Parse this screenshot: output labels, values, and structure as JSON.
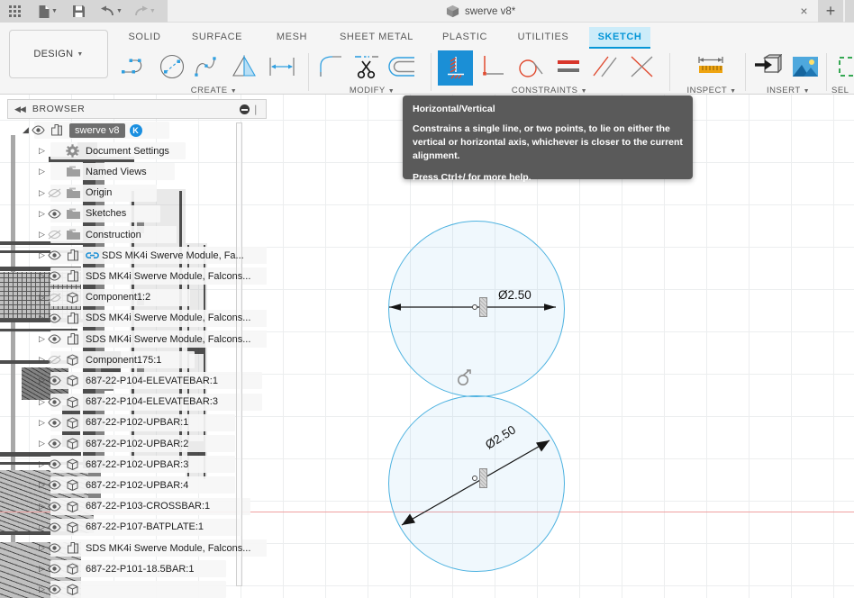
{
  "app": {
    "document_tab": "swerve v8*",
    "close_label": "×",
    "new_tab_label": "+"
  },
  "quick_access": {
    "items": [
      {
        "name": "app-grid-icon",
        "label": "grid-icon"
      },
      {
        "name": "new-file-icon",
        "label": "file-icon"
      },
      {
        "name": "save-icon",
        "label": "save-icon"
      },
      {
        "name": "undo-icon",
        "label": "undo-icon"
      },
      {
        "name": "redo-icon",
        "label": "redo-icon"
      }
    ]
  },
  "ribbon": {
    "design_button": "DESIGN",
    "workspace_tabs": [
      {
        "label": "SOLID",
        "active": false
      },
      {
        "label": "SURFACE",
        "active": false
      },
      {
        "label": "MESH",
        "active": false
      },
      {
        "label": "SHEET METAL",
        "active": false
      },
      {
        "label": "PLASTIC",
        "active": false
      },
      {
        "label": "UTILITIES",
        "active": false
      },
      {
        "label": "SKETCH",
        "active": true
      }
    ],
    "groups": [
      {
        "label": "CREATE",
        "tools": [
          "line-icon",
          "circle-icon",
          "spline-icon",
          "mirror-icon",
          "sketch-dimension-icon"
        ]
      },
      {
        "label": "MODIFY",
        "tools": [
          "fillet-icon",
          "trim-scissors-icon",
          "offset-icon"
        ]
      },
      {
        "label": "CONSTRAINTS",
        "tools": [
          "horizontal-vertical-icon",
          "perpendicular-icon",
          "tangent-icon",
          "equal-icon",
          "parallel-icon",
          "midpoint-icon"
        ]
      },
      {
        "label": "INSPECT",
        "tools": [
          "measure-ruler-icon"
        ]
      },
      {
        "label": "INSERT",
        "tools": [
          "insert-derive-icon",
          "insert-canvas-image-icon"
        ]
      },
      {
        "label": "SEL",
        "tools": [
          "selection-filter-icon"
        ]
      }
    ]
  },
  "tooltip": {
    "title": "Horizontal/Vertical",
    "body": "Constrains a single line, or two points, to lie on either the vertical or horizontal axis, whichever is closer to the current alignment.",
    "footer": "Press Ctrl+/ for more help."
  },
  "browser": {
    "title": "BROWSER",
    "collapse_label": "◀◀",
    "items": [
      {
        "indent": 0,
        "arrow": "◢",
        "eye": "visible",
        "icon": "component-icon",
        "label": "swerve v8",
        "selected": true,
        "badge": "K",
        "link": false
      },
      {
        "indent": 1,
        "arrow": "▷",
        "eye": "none",
        "icon": "gear-icon",
        "label": "Document Settings",
        "selected": false,
        "badge": "",
        "link": false
      },
      {
        "indent": 1,
        "arrow": "▷",
        "eye": "none",
        "icon": "folder-icon",
        "label": "Named Views",
        "selected": false,
        "badge": "",
        "link": false
      },
      {
        "indent": 1,
        "arrow": "▷",
        "eye": "hidden",
        "icon": "folder-icon",
        "label": "Origin",
        "selected": false,
        "badge": "",
        "link": false
      },
      {
        "indent": 1,
        "arrow": "▷",
        "eye": "visible",
        "icon": "folder-icon",
        "label": "Sketches",
        "selected": false,
        "badge": "",
        "link": false
      },
      {
        "indent": 1,
        "arrow": "▷",
        "eye": "hidden",
        "icon": "folder-icon",
        "label": "Construction",
        "selected": false,
        "badge": "",
        "link": false
      },
      {
        "indent": 1,
        "arrow": "▷",
        "eye": "visible",
        "icon": "component-icon",
        "label": "SDS MK4i Swerve Module, Fa...",
        "selected": false,
        "badge": "",
        "link": true
      },
      {
        "indent": 1,
        "arrow": "▷",
        "eye": "visible",
        "icon": "component-icon",
        "label": "SDS MK4i Swerve Module, Falcons...",
        "selected": false,
        "badge": "",
        "link": false
      },
      {
        "indent": 1,
        "arrow": "▷",
        "eye": "hidden",
        "icon": "body-icon",
        "label": "Component1:2",
        "selected": false,
        "badge": "",
        "link": false
      },
      {
        "indent": 1,
        "arrow": "▷",
        "eye": "visible",
        "icon": "component-icon",
        "label": "SDS MK4i Swerve Module, Falcons...",
        "selected": false,
        "badge": "",
        "link": false
      },
      {
        "indent": 1,
        "arrow": "▷",
        "eye": "visible",
        "icon": "component-icon",
        "label": "SDS MK4i Swerve Module, Falcons...",
        "selected": false,
        "badge": "",
        "link": false
      },
      {
        "indent": 1,
        "arrow": "▷",
        "eye": "hidden",
        "icon": "body-icon",
        "label": "Component175:1",
        "selected": false,
        "badge": "",
        "link": false
      },
      {
        "indent": 1,
        "arrow": "▷",
        "eye": "visible",
        "icon": "body-icon",
        "label": "687-22-P104-ELEVATEBAR:1",
        "selected": false,
        "badge": "",
        "link": false
      },
      {
        "indent": 1,
        "arrow": "▷",
        "eye": "visible",
        "icon": "body-icon",
        "label": "687-22-P104-ELEVATEBAR:3",
        "selected": false,
        "badge": "",
        "link": false
      },
      {
        "indent": 1,
        "arrow": "▷",
        "eye": "visible",
        "icon": "body-icon",
        "label": "687-22-P102-UPBAR:1",
        "selected": false,
        "badge": "",
        "link": false
      },
      {
        "indent": 1,
        "arrow": "▷",
        "eye": "visible",
        "icon": "body-icon",
        "label": "687-22-P102-UPBAR:2",
        "selected": false,
        "badge": "",
        "link": false
      },
      {
        "indent": 1,
        "arrow": "▷",
        "eye": "visible",
        "icon": "body-icon",
        "label": "687-22-P102-UPBAR:3",
        "selected": false,
        "badge": "",
        "link": false
      },
      {
        "indent": 1,
        "arrow": "▷",
        "eye": "visible",
        "icon": "body-icon",
        "label": "687-22-P102-UPBAR:4",
        "selected": false,
        "badge": "",
        "link": false
      },
      {
        "indent": 1,
        "arrow": "▷",
        "eye": "visible",
        "icon": "body-icon",
        "label": "687-22-P103-CROSSBAR:1",
        "selected": false,
        "badge": "",
        "link": false
      },
      {
        "indent": 1,
        "arrow": "▷",
        "eye": "visible",
        "icon": "body-icon",
        "label": "687-22-P107-BATPLATE:1",
        "selected": false,
        "badge": "",
        "link": false
      },
      {
        "indent": 1,
        "arrow": "▷",
        "eye": "visible",
        "icon": "component-icon",
        "label": "SDS MK4i Swerve Module, Falcons...",
        "selected": false,
        "badge": "",
        "link": false
      },
      {
        "indent": 1,
        "arrow": "▷",
        "eye": "visible",
        "icon": "body-icon",
        "label": "687-22-P101-18.5BAR:1",
        "selected": false,
        "badge": "",
        "link": false
      },
      {
        "indent": 1,
        "arrow": "▷",
        "eye": "visible",
        "icon": "body-icon",
        "label": "",
        "selected": false,
        "badge": "",
        "link": false
      }
    ]
  },
  "canvas": {
    "dimension_top": "Ø2.50",
    "dimension_bottom": "Ø2.50",
    "constraint_glyph": "horizontal-vertical-marker",
    "colors": {
      "sketch_curve": "#4db2e0",
      "sketch_fill": "#e8f5fc",
      "x_axis": "#f0a0a0",
      "grid": "#eceeef",
      "accent": "#0696d7"
    }
  }
}
